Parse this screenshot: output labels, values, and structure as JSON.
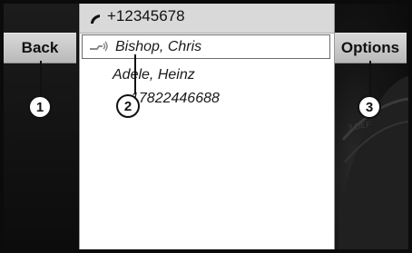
{
  "header": {
    "number": "+12345678"
  },
  "buttons": {
    "back": "Back",
    "options": "Options"
  },
  "list": {
    "selected": "Bishop, Chris",
    "items": [
      "Adele, Heinz",
      "17822446688"
    ]
  },
  "callouts": [
    "1",
    "2",
    "3"
  ],
  "colors": {
    "panel": "#141414",
    "button": "#c8c8c8",
    "header": "#d9d9d9"
  }
}
